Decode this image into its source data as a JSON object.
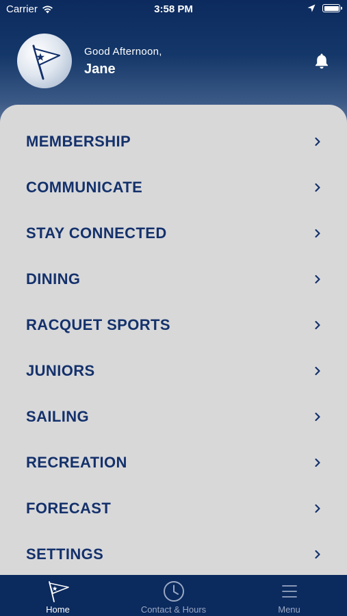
{
  "status_bar": {
    "carrier": "Carrier",
    "time": "3:58 PM"
  },
  "header": {
    "greeting": "Good Afternoon,",
    "user_name": "Jane",
    "notification_icon": "bell-icon"
  },
  "menu": {
    "items": [
      {
        "label": "MEMBERSHIP"
      },
      {
        "label": "COMMUNICATE"
      },
      {
        "label": "STAY CONNECTED"
      },
      {
        "label": "DINING"
      },
      {
        "label": "RACQUET SPORTS"
      },
      {
        "label": "JUNIORS"
      },
      {
        "label": "SAILING"
      },
      {
        "label": "RECREATION"
      },
      {
        "label": "FORECAST"
      },
      {
        "label": "SETTINGS"
      }
    ]
  },
  "tab_bar": {
    "tabs": [
      {
        "label": "Home",
        "icon": "flag-icon",
        "active": true
      },
      {
        "label": "Contact & Hours",
        "icon": "clock-icon",
        "active": false
      },
      {
        "label": "Menu",
        "icon": "hamburger-menu-icon",
        "active": false
      }
    ]
  },
  "colors": {
    "brand_navy": "#0b2a5e",
    "menu_text": "#14316b",
    "menu_panel": "#d8d8d9",
    "tab_inactive": "#9aa9c4"
  }
}
